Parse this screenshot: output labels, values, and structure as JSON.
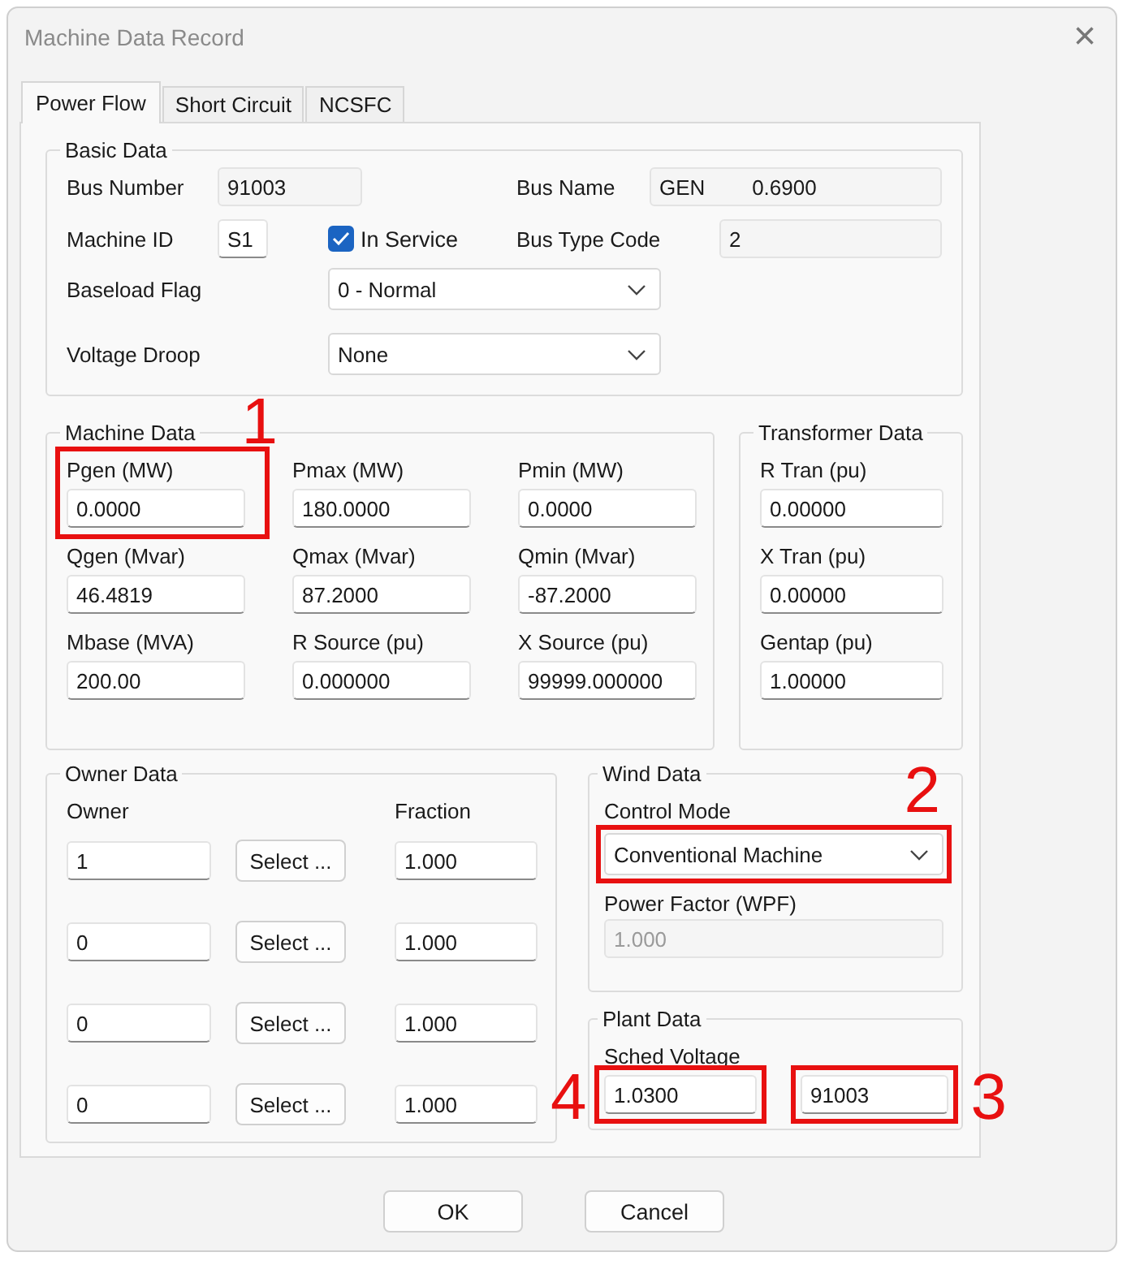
{
  "window": {
    "title": "Machine Data Record",
    "close": "×"
  },
  "tabs": [
    {
      "label": "Power Flow",
      "selected": true
    },
    {
      "label": "Short Circuit",
      "selected": false
    },
    {
      "label": "NCSFC",
      "selected": false
    }
  ],
  "basic_data": {
    "title": "Basic Data",
    "bus_number": {
      "label": "Bus Number",
      "value": "91003",
      "disabled": true
    },
    "bus_name": {
      "label": "Bus Name",
      "value": "GEN        0.6900",
      "disabled": true
    },
    "machine_id": {
      "label": "Machine ID",
      "value": "S1"
    },
    "in_service": {
      "label": "In Service",
      "checked": true
    },
    "bus_type_code": {
      "label": "Bus Type Code",
      "value": "2",
      "disabled": true
    },
    "baseload_flag": {
      "label": "Baseload Flag",
      "value": "0 - Normal"
    },
    "voltage_droop": {
      "label": "Voltage Droop",
      "value": "None"
    }
  },
  "machine_data": {
    "title": "Machine Data",
    "fields": [
      {
        "label": "Pgen (MW)",
        "value": "0.0000",
        "callout": "1"
      },
      {
        "label": "Pmax (MW)",
        "value": "180.0000"
      },
      {
        "label": "Pmin (MW)",
        "value": "0.0000"
      },
      {
        "label": "Qgen (Mvar)",
        "value": "46.4819"
      },
      {
        "label": "Qmax (Mvar)",
        "value": "87.2000"
      },
      {
        "label": "Qmin (Mvar)",
        "value": "-87.2000"
      },
      {
        "label": "Mbase (MVA)",
        "value": "200.00"
      },
      {
        "label": "R Source (pu)",
        "value": "0.000000"
      },
      {
        "label": "X Source (pu)",
        "value": "99999.000000"
      }
    ]
  },
  "transformer_data": {
    "title": "Transformer Data",
    "fields": [
      {
        "label": "R Tran (pu)",
        "value": "0.00000"
      },
      {
        "label": "X Tran (pu)",
        "value": "0.00000"
      },
      {
        "label": "Gentap (pu)",
        "value": "1.00000"
      }
    ]
  },
  "owner_data": {
    "title": "Owner Data",
    "owner_header": "Owner",
    "fraction_header": "Fraction",
    "rows": [
      {
        "owner": "1",
        "button": "Select ...",
        "fraction": "1.000"
      },
      {
        "owner": "0",
        "button": "Select ...",
        "fraction": "1.000"
      },
      {
        "owner": "0",
        "button": "Select ...",
        "fraction": "1.000"
      },
      {
        "owner": "0",
        "button": "Select ...",
        "fraction": "1.000"
      }
    ]
  },
  "wind_data": {
    "title": "Wind Data",
    "control_mode": {
      "label": "Control Mode",
      "value": "Conventional Machine",
      "callout": "2"
    },
    "power_factor": {
      "label": "Power Factor (WPF)",
      "value": "1.000",
      "disabled": true
    }
  },
  "plant_data": {
    "title": "Plant Data",
    "sched_voltage": {
      "label": "Sched Voltage",
      "value": "1.0300",
      "callout": "4"
    },
    "remote_bus": {
      "value": "91003",
      "callout": "3"
    }
  },
  "buttons": [
    "OK",
    "Cancel"
  ]
}
